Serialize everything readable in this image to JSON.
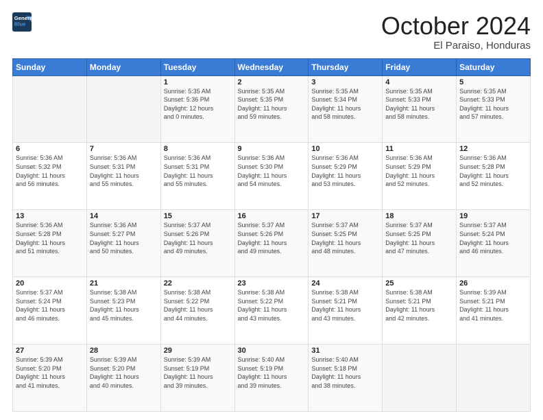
{
  "logo": {
    "line1": "General",
    "line2": "Blue"
  },
  "title": "October 2024",
  "subtitle": "El Paraiso, Honduras",
  "header_days": [
    "Sunday",
    "Monday",
    "Tuesday",
    "Wednesday",
    "Thursday",
    "Friday",
    "Saturday"
  ],
  "weeks": [
    [
      {
        "day": "",
        "info": ""
      },
      {
        "day": "",
        "info": ""
      },
      {
        "day": "1",
        "info": "Sunrise: 5:35 AM\nSunset: 5:36 PM\nDaylight: 12 hours\nand 0 minutes."
      },
      {
        "day": "2",
        "info": "Sunrise: 5:35 AM\nSunset: 5:35 PM\nDaylight: 11 hours\nand 59 minutes."
      },
      {
        "day": "3",
        "info": "Sunrise: 5:35 AM\nSunset: 5:34 PM\nDaylight: 11 hours\nand 58 minutes."
      },
      {
        "day": "4",
        "info": "Sunrise: 5:35 AM\nSunset: 5:33 PM\nDaylight: 11 hours\nand 58 minutes."
      },
      {
        "day": "5",
        "info": "Sunrise: 5:35 AM\nSunset: 5:33 PM\nDaylight: 11 hours\nand 57 minutes."
      }
    ],
    [
      {
        "day": "6",
        "info": "Sunrise: 5:36 AM\nSunset: 5:32 PM\nDaylight: 11 hours\nand 56 minutes."
      },
      {
        "day": "7",
        "info": "Sunrise: 5:36 AM\nSunset: 5:31 PM\nDaylight: 11 hours\nand 55 minutes."
      },
      {
        "day": "8",
        "info": "Sunrise: 5:36 AM\nSunset: 5:31 PM\nDaylight: 11 hours\nand 55 minutes."
      },
      {
        "day": "9",
        "info": "Sunrise: 5:36 AM\nSunset: 5:30 PM\nDaylight: 11 hours\nand 54 minutes."
      },
      {
        "day": "10",
        "info": "Sunrise: 5:36 AM\nSunset: 5:29 PM\nDaylight: 11 hours\nand 53 minutes."
      },
      {
        "day": "11",
        "info": "Sunrise: 5:36 AM\nSunset: 5:29 PM\nDaylight: 11 hours\nand 52 minutes."
      },
      {
        "day": "12",
        "info": "Sunrise: 5:36 AM\nSunset: 5:28 PM\nDaylight: 11 hours\nand 52 minutes."
      }
    ],
    [
      {
        "day": "13",
        "info": "Sunrise: 5:36 AM\nSunset: 5:28 PM\nDaylight: 11 hours\nand 51 minutes."
      },
      {
        "day": "14",
        "info": "Sunrise: 5:36 AM\nSunset: 5:27 PM\nDaylight: 11 hours\nand 50 minutes."
      },
      {
        "day": "15",
        "info": "Sunrise: 5:37 AM\nSunset: 5:26 PM\nDaylight: 11 hours\nand 49 minutes."
      },
      {
        "day": "16",
        "info": "Sunrise: 5:37 AM\nSunset: 5:26 PM\nDaylight: 11 hours\nand 49 minutes."
      },
      {
        "day": "17",
        "info": "Sunrise: 5:37 AM\nSunset: 5:25 PM\nDaylight: 11 hours\nand 48 minutes."
      },
      {
        "day": "18",
        "info": "Sunrise: 5:37 AM\nSunset: 5:25 PM\nDaylight: 11 hours\nand 47 minutes."
      },
      {
        "day": "19",
        "info": "Sunrise: 5:37 AM\nSunset: 5:24 PM\nDaylight: 11 hours\nand 46 minutes."
      }
    ],
    [
      {
        "day": "20",
        "info": "Sunrise: 5:37 AM\nSunset: 5:24 PM\nDaylight: 11 hours\nand 46 minutes."
      },
      {
        "day": "21",
        "info": "Sunrise: 5:38 AM\nSunset: 5:23 PM\nDaylight: 11 hours\nand 45 minutes."
      },
      {
        "day": "22",
        "info": "Sunrise: 5:38 AM\nSunset: 5:22 PM\nDaylight: 11 hours\nand 44 minutes."
      },
      {
        "day": "23",
        "info": "Sunrise: 5:38 AM\nSunset: 5:22 PM\nDaylight: 11 hours\nand 43 minutes."
      },
      {
        "day": "24",
        "info": "Sunrise: 5:38 AM\nSunset: 5:21 PM\nDaylight: 11 hours\nand 43 minutes."
      },
      {
        "day": "25",
        "info": "Sunrise: 5:38 AM\nSunset: 5:21 PM\nDaylight: 11 hours\nand 42 minutes."
      },
      {
        "day": "26",
        "info": "Sunrise: 5:39 AM\nSunset: 5:21 PM\nDaylight: 11 hours\nand 41 minutes."
      }
    ],
    [
      {
        "day": "27",
        "info": "Sunrise: 5:39 AM\nSunset: 5:20 PM\nDaylight: 11 hours\nand 41 minutes."
      },
      {
        "day": "28",
        "info": "Sunrise: 5:39 AM\nSunset: 5:20 PM\nDaylight: 11 hours\nand 40 minutes."
      },
      {
        "day": "29",
        "info": "Sunrise: 5:39 AM\nSunset: 5:19 PM\nDaylight: 11 hours\nand 39 minutes."
      },
      {
        "day": "30",
        "info": "Sunrise: 5:40 AM\nSunset: 5:19 PM\nDaylight: 11 hours\nand 39 minutes."
      },
      {
        "day": "31",
        "info": "Sunrise: 5:40 AM\nSunset: 5:18 PM\nDaylight: 11 hours\nand 38 minutes."
      },
      {
        "day": "",
        "info": ""
      },
      {
        "day": "",
        "info": ""
      }
    ]
  ]
}
